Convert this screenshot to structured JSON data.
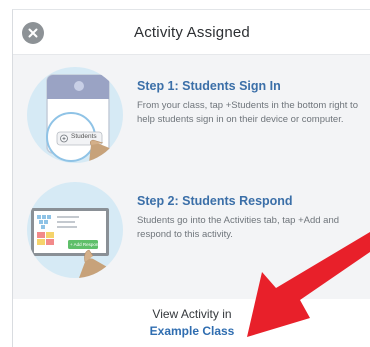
{
  "modal": {
    "title": "Activity Assigned",
    "close_icon": "close-icon"
  },
  "steps": [
    {
      "title": "Step 1: Students Sign In",
      "description": "From your class, tap +Students in the bottom right to help students sign in on their device or computer.",
      "illustration_button_label": "Students"
    },
    {
      "title": "Step 2: Students Respond",
      "description": "Students go into the Activities tab, tap +Add and respond to this activity.",
      "illustration_button_label": "+ Add Response"
    }
  ],
  "footer": {
    "label": "View Activity in",
    "link": "Example Class"
  },
  "annotation": {
    "arrow_color": "#e8202a"
  }
}
